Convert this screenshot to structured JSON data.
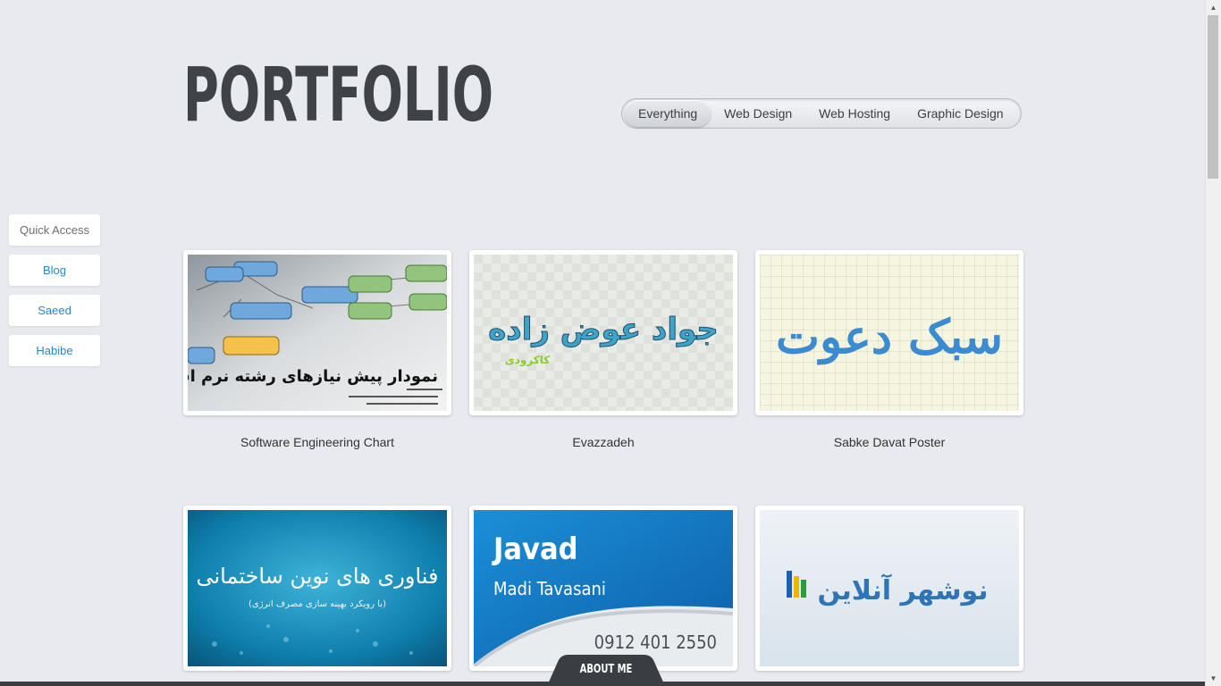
{
  "page": {
    "title": "PORTFOLIO"
  },
  "filters": [
    {
      "label": "Everything",
      "active": true
    },
    {
      "label": "Web Design",
      "active": false
    },
    {
      "label": "Web Hosting",
      "active": false
    },
    {
      "label": "Graphic Design",
      "active": false
    }
  ],
  "side_nav": {
    "header": "Quick Access",
    "items": [
      "Blog",
      "Saeed",
      "Habibe"
    ]
  },
  "portfolio": [
    {
      "caption": "Software Engineering Chart",
      "thumb_text": "نمودار پیش نیازهای رشته نرم افزار"
    },
    {
      "caption": "Evazzadeh",
      "thumb_text": "جواد عوض زاده",
      "thumb_subtext": "کاکرودی"
    },
    {
      "caption": "Sabke Davat Poster",
      "thumb_text": "سبک دعوت"
    },
    {
      "caption": "",
      "thumb_text": "فناوری های نوین ساختمانی",
      "thumb_subtext": "(با رویکرد بهینه سازی مصرف انرژی)"
    },
    {
      "caption": "",
      "thumb_text": "Javad",
      "thumb_subtext": "Madi Tavasani",
      "thumb_phone": "0912 401 2550"
    },
    {
      "caption": "",
      "thumb_text": "نوشهر آنلاین"
    }
  ],
  "footer": {
    "about_label": "ABOUT ME"
  },
  "colors": {
    "background": "#e8eaef",
    "link": "#2a86c8",
    "title": "#3f4348",
    "bar": "#3a3d42"
  }
}
